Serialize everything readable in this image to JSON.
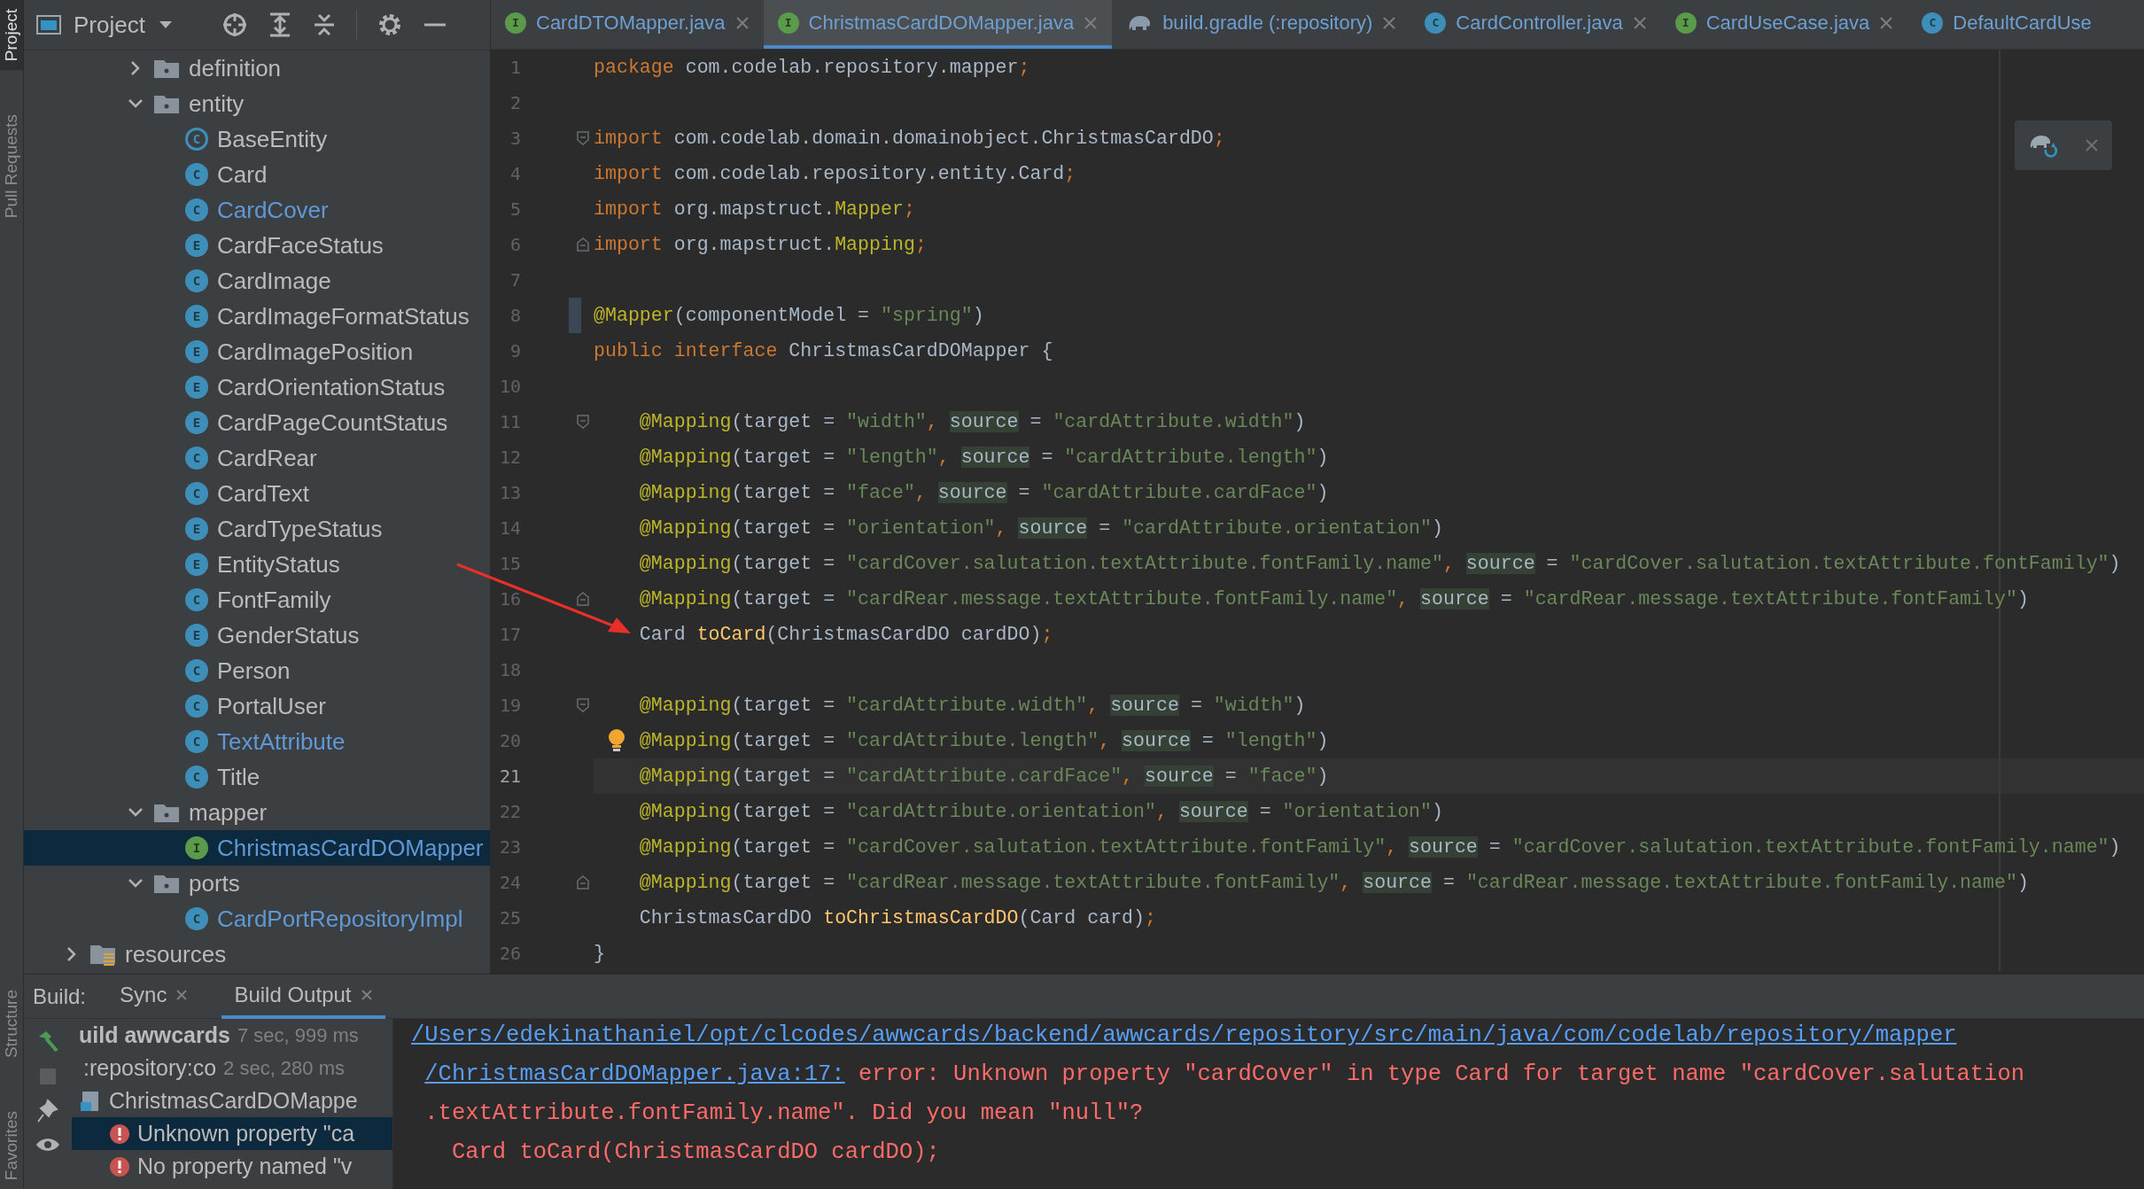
{
  "tool_strip": {
    "top": [
      {
        "label": "Project",
        "selected": true
      },
      {
        "label": "Pull Requests",
        "selected": false
      }
    ],
    "bottom": [
      {
        "label": "Structure",
        "selected": false
      },
      {
        "label": "Favorites",
        "selected": false
      }
    ]
  },
  "project": {
    "title": "Project",
    "tree": [
      {
        "label": "definition",
        "kind": "folder",
        "expanded": false,
        "selected": false
      },
      {
        "label": "entity",
        "kind": "folder",
        "expanded": true,
        "selected": false,
        "children": [
          {
            "label": "BaseEntity",
            "kind": "abstract",
            "badge": "C",
            "modified": false,
            "selected": false
          },
          {
            "label": "Card",
            "kind": "class",
            "badge": "C",
            "modified": false,
            "selected": false
          },
          {
            "label": "CardCover",
            "kind": "class",
            "badge": "C",
            "modified": true,
            "selected": false
          },
          {
            "label": "CardFaceStatus",
            "kind": "enum",
            "badge": "E",
            "modified": false,
            "selected": false
          },
          {
            "label": "CardImage",
            "kind": "class",
            "badge": "C",
            "modified": false,
            "selected": false
          },
          {
            "label": "CardImageFormatStatus",
            "kind": "enum",
            "badge": "E",
            "modified": false,
            "selected": false
          },
          {
            "label": "CardImagePosition",
            "kind": "enum",
            "badge": "E",
            "modified": false,
            "selected": false
          },
          {
            "label": "CardOrientationStatus",
            "kind": "enum",
            "badge": "E",
            "modified": false,
            "selected": false
          },
          {
            "label": "CardPageCountStatus",
            "kind": "enum",
            "badge": "E",
            "modified": false,
            "selected": false
          },
          {
            "label": "CardRear",
            "kind": "class",
            "badge": "C",
            "modified": false,
            "selected": false
          },
          {
            "label": "CardText",
            "kind": "class",
            "badge": "C",
            "modified": false,
            "selected": false
          },
          {
            "label": "CardTypeStatus",
            "kind": "enum",
            "badge": "E",
            "modified": false,
            "selected": false
          },
          {
            "label": "EntityStatus",
            "kind": "enum",
            "badge": "E",
            "modified": false,
            "selected": false
          },
          {
            "label": "FontFamily",
            "kind": "class",
            "badge": "C",
            "modified": false,
            "selected": false
          },
          {
            "label": "GenderStatus",
            "kind": "enum",
            "badge": "E",
            "modified": false,
            "selected": false
          },
          {
            "label": "Person",
            "kind": "class",
            "badge": "C",
            "modified": false,
            "selected": false
          },
          {
            "label": "PortalUser",
            "kind": "class",
            "badge": "C",
            "modified": false,
            "selected": false
          },
          {
            "label": "TextAttribute",
            "kind": "class",
            "badge": "C",
            "modified": true,
            "selected": false
          },
          {
            "label": "Title",
            "kind": "class",
            "badge": "C",
            "modified": false,
            "selected": false
          }
        ]
      },
      {
        "label": "mapper",
        "kind": "folder",
        "expanded": true,
        "selected": false,
        "children": [
          {
            "label": "ChristmasCardDOMapper",
            "kind": "interface",
            "badge": "I",
            "modified": true,
            "selected": true
          }
        ]
      },
      {
        "label": "ports",
        "kind": "folder",
        "expanded": true,
        "selected": false,
        "children": [
          {
            "label": "CardPortRepositoryImpl",
            "kind": "class",
            "badge": "C",
            "modified": true,
            "selected": false
          }
        ]
      }
    ],
    "outer_tree": [
      {
        "label": "resources",
        "kind": "resources-folder",
        "expanded": false,
        "selected": false
      }
    ]
  },
  "tabs": [
    {
      "label": "CardDTOMapper.java",
      "kind": "interface",
      "badge": "I",
      "selected": false
    },
    {
      "label": "ChristmasCardDOMapper.java",
      "kind": "interface",
      "badge": "I",
      "selected": true
    },
    {
      "label": "build.gradle (:repository)",
      "kind": "gradle",
      "selected": false
    },
    {
      "label": "CardController.java",
      "kind": "class",
      "badge": "C",
      "selected": false
    },
    {
      "label": "CardUseCase.java",
      "kind": "interface",
      "badge": "I",
      "selected": false
    },
    {
      "label": "DefaultCardUse",
      "kind": "class",
      "badge": "C",
      "selected": false
    }
  ],
  "editor": {
    "lines": [
      {
        "number": "1",
        "current": false,
        "segments": [
          {
            "kind": "kw",
            "text": "package"
          },
          {
            "kind": "plain",
            "text": " com.codelab.repository.mapper"
          },
          {
            "kind": "kw",
            "text": ";"
          }
        ]
      },
      {
        "number": "2",
        "current": false
      },
      {
        "number": "3",
        "current": false,
        "fold_start": true,
        "segments": [
          {
            "kind": "kw",
            "text": "import"
          },
          {
            "kind": "plain",
            "text": " com.codelab.domain.domainobject.ChristmasCardDO"
          },
          {
            "kind": "kw",
            "text": ";"
          }
        ]
      },
      {
        "number": "4",
        "current": false,
        "segments": [
          {
            "kind": "kw",
            "text": "import"
          },
          {
            "kind": "plain",
            "text": " com.codelab.repository.entity.Card"
          },
          {
            "kind": "kw",
            "text": ";"
          }
        ]
      },
      {
        "number": "5",
        "current": false,
        "segments": [
          {
            "kind": "kw",
            "text": "import"
          },
          {
            "kind": "plain",
            "text": " org.mapstruct."
          },
          {
            "kind": "ann",
            "text": "Mapper"
          },
          {
            "kind": "kw",
            "text": ";"
          }
        ]
      },
      {
        "number": "6",
        "current": false,
        "fold_end": true,
        "segments": [
          {
            "kind": "kw",
            "text": "import"
          },
          {
            "kind": "plain",
            "text": " org.mapstruct."
          },
          {
            "kind": "ann",
            "text": "Mapping"
          },
          {
            "kind": "kw",
            "text": ";"
          }
        ]
      },
      {
        "number": "7",
        "current": false
      },
      {
        "number": "8",
        "current": false,
        "changed": true,
        "segments": [
          {
            "kind": "ann",
            "text": "@Mapper"
          },
          {
            "kind": "plain",
            "text": "(componentModel = "
          },
          {
            "kind": "str",
            "text": "\"spring\""
          },
          {
            "kind": "plain",
            "text": ")"
          }
        ]
      },
      {
        "number": "9",
        "current": false,
        "segments": [
          {
            "kind": "kw",
            "text": "public interface"
          },
          {
            "kind": "plain",
            "text": " ChristmasCardDOMapper {"
          }
        ]
      },
      {
        "number": "10",
        "current": false
      },
      {
        "number": "11",
        "current": false,
        "indented": true,
        "fold_start": true,
        "segments": [
          {
            "kind": "ann",
            "text": "@Mapping"
          },
          {
            "kind": "plain",
            "text": "(target = "
          },
          {
            "kind": "str",
            "text": "\"width\""
          },
          {
            "kind": "kw",
            "text": ", "
          },
          {
            "kind": "hl",
            "text": "source"
          },
          {
            "kind": "plain",
            "text": " = "
          },
          {
            "kind": "str",
            "text": "\"cardAttribute.width\""
          },
          {
            "kind": "plain",
            "text": ")"
          }
        ]
      },
      {
        "number": "12",
        "current": false,
        "indented": true,
        "segments": [
          {
            "kind": "ann",
            "text": "@Mapping"
          },
          {
            "kind": "plain",
            "text": "(target = "
          },
          {
            "kind": "str",
            "text": "\"length\""
          },
          {
            "kind": "kw",
            "text": ", "
          },
          {
            "kind": "hl",
            "text": "source"
          },
          {
            "kind": "plain",
            "text": " = "
          },
          {
            "kind": "str",
            "text": "\"cardAttribute.length\""
          },
          {
            "kind": "plain",
            "text": ")"
          }
        ]
      },
      {
        "number": "13",
        "current": false,
        "indented": true,
        "segments": [
          {
            "kind": "ann",
            "text": "@Mapping"
          },
          {
            "kind": "plain",
            "text": "(target = "
          },
          {
            "kind": "str",
            "text": "\"face\""
          },
          {
            "kind": "kw",
            "text": ", "
          },
          {
            "kind": "hl",
            "text": "source"
          },
          {
            "kind": "plain",
            "text": " = "
          },
          {
            "kind": "str",
            "text": "\"cardAttribute.cardFace\""
          },
          {
            "kind": "plain",
            "text": ")"
          }
        ]
      },
      {
        "number": "14",
        "current": false,
        "indented": true,
        "segments": [
          {
            "kind": "ann",
            "text": "@Mapping"
          },
          {
            "kind": "plain",
            "text": "(target = "
          },
          {
            "kind": "str",
            "text": "\"orientation\""
          },
          {
            "kind": "kw",
            "text": ", "
          },
          {
            "kind": "hl",
            "text": "source"
          },
          {
            "kind": "plain",
            "text": " = "
          },
          {
            "kind": "str",
            "text": "\"cardAttribute.orientation\""
          },
          {
            "kind": "plain",
            "text": ")"
          }
        ]
      },
      {
        "number": "15",
        "current": false,
        "indented": true,
        "segments": [
          {
            "kind": "ann",
            "text": "@Mapping"
          },
          {
            "kind": "plain",
            "text": "(target = "
          },
          {
            "kind": "str",
            "text": "\"cardCover.salutation.textAttribute.fontFamily.name\""
          },
          {
            "kind": "kw",
            "text": ", "
          },
          {
            "kind": "hl",
            "text": "source"
          },
          {
            "kind": "plain",
            "text": " = "
          },
          {
            "kind": "str",
            "text": "\"cardCover.salutation.textAttribute.fontFamily\""
          },
          {
            "kind": "plain",
            "text": ")"
          }
        ]
      },
      {
        "number": "16",
        "current": false,
        "indented": true,
        "fold_end": true,
        "segments": [
          {
            "kind": "ann",
            "text": "@Mapping"
          },
          {
            "kind": "plain",
            "text": "(target = "
          },
          {
            "kind": "str",
            "text": "\"cardRear.message.textAttribute.fontFamily.name\""
          },
          {
            "kind": "kw",
            "text": ", "
          },
          {
            "kind": "hl",
            "text": "source"
          },
          {
            "kind": "plain",
            "text": " = "
          },
          {
            "kind": "str",
            "text": "\"cardRear.message.textAttribute.fontFamily\""
          },
          {
            "kind": "plain",
            "text": ")"
          }
        ]
      },
      {
        "number": "17",
        "current": false,
        "indented": true,
        "segments": [
          {
            "kind": "plain",
            "text": "Card "
          },
          {
            "kind": "fn",
            "text": "toCard"
          },
          {
            "kind": "plain",
            "text": "(ChristmasCardDO cardDO)"
          },
          {
            "kind": "kw",
            "text": ";"
          }
        ]
      },
      {
        "number": "18",
        "current": false
      },
      {
        "number": "19",
        "current": false,
        "indented": true,
        "fold_start": true,
        "segments": [
          {
            "kind": "ann",
            "text": "@Mapping"
          },
          {
            "kind": "plain",
            "text": "(target = "
          },
          {
            "kind": "str",
            "text": "\"cardAttribute.width\""
          },
          {
            "kind": "kw",
            "text": ", "
          },
          {
            "kind": "hl",
            "text": "source"
          },
          {
            "kind": "plain",
            "text": " = "
          },
          {
            "kind": "str",
            "text": "\"width\""
          },
          {
            "kind": "plain",
            "text": ")"
          }
        ]
      },
      {
        "number": "20",
        "current": false,
        "indented": true,
        "bulb": true,
        "segments": [
          {
            "kind": "ann",
            "text": "@Mapping"
          },
          {
            "kind": "plain",
            "text": "(target = "
          },
          {
            "kind": "str",
            "text": "\"cardAttribute.length\""
          },
          {
            "kind": "kw",
            "text": ", "
          },
          {
            "kind": "hl",
            "text": "source"
          },
          {
            "kind": "plain",
            "text": " = "
          },
          {
            "kind": "str",
            "text": "\"length\""
          },
          {
            "kind": "plain",
            "text": ")"
          }
        ]
      },
      {
        "number": "21",
        "current": true,
        "indented": true,
        "segments": [
          {
            "kind": "ann",
            "text": "@Mapping"
          },
          {
            "kind": "plain",
            "text": "(target = "
          },
          {
            "kind": "str",
            "text": "\"cardAttribute.cardFace\""
          },
          {
            "kind": "kw",
            "text": ", "
          },
          {
            "kind": "hl",
            "text": "source"
          },
          {
            "kind": "plain",
            "text": " = "
          },
          {
            "kind": "str",
            "text": "\"face\""
          },
          {
            "kind": "plain",
            "text": ")"
          }
        ]
      },
      {
        "number": "22",
        "current": false,
        "indented": true,
        "segments": [
          {
            "kind": "ann",
            "text": "@Mapping"
          },
          {
            "kind": "plain",
            "text": "(target = "
          },
          {
            "kind": "str",
            "text": "\"cardAttribute.orientation\""
          },
          {
            "kind": "kw",
            "text": ", "
          },
          {
            "kind": "hl",
            "text": "source"
          },
          {
            "kind": "plain",
            "text": " = "
          },
          {
            "kind": "str",
            "text": "\"orientation\""
          },
          {
            "kind": "plain",
            "text": ")"
          }
        ]
      },
      {
        "number": "23",
        "current": false,
        "indented": true,
        "segments": [
          {
            "kind": "ann",
            "text": "@Mapping"
          },
          {
            "kind": "plain",
            "text": "(target = "
          },
          {
            "kind": "str",
            "text": "\"cardCover.salutation.textAttribute.fontFamily\""
          },
          {
            "kind": "kw",
            "text": ", "
          },
          {
            "kind": "hl",
            "text": "source"
          },
          {
            "kind": "plain",
            "text": " = "
          },
          {
            "kind": "str",
            "text": "\"cardCover.salutation.textAttribute.fontFamily.name\""
          },
          {
            "kind": "plain",
            "text": ")"
          }
        ]
      },
      {
        "number": "24",
        "current": false,
        "indented": true,
        "fold_end": true,
        "segments": [
          {
            "kind": "ann",
            "text": "@Mapping"
          },
          {
            "kind": "plain",
            "text": "(target = "
          },
          {
            "kind": "str",
            "text": "\"cardRear.message.textAttribute.fontFamily\""
          },
          {
            "kind": "kw",
            "text": ", "
          },
          {
            "kind": "hl",
            "text": "source"
          },
          {
            "kind": "plain",
            "text": " = "
          },
          {
            "kind": "str",
            "text": "\"cardRear.message.textAttribute.fontFamily.name\""
          },
          {
            "kind": "plain",
            "text": ")"
          }
        ]
      },
      {
        "number": "25",
        "current": false,
        "indented": true,
        "segments": [
          {
            "kind": "plain",
            "text": "ChristmasCardDO "
          },
          {
            "kind": "fn",
            "text": "toChristmasCardDO"
          },
          {
            "kind": "plain",
            "text": "(Card card)"
          },
          {
            "kind": "kw",
            "text": ";"
          }
        ]
      },
      {
        "number": "26",
        "current": false,
        "segments": [
          {
            "kind": "plain",
            "text": "}"
          }
        ]
      }
    ]
  },
  "build": {
    "label": "Build:",
    "tabs": [
      {
        "label": "Sync",
        "selected": false
      },
      {
        "label": "Build Output",
        "selected": true
      }
    ],
    "tree": [
      {
        "label": "uild awwcards",
        "time": "7 sec, 999 ms",
        "selected": false,
        "children": [
          {
            "label": ":repository:co",
            "time": "2 sec, 280 ms",
            "selected": false,
            "children": [
              {
                "label": "ChristmasCardDOMappe",
                "kind": "file",
                "selected": false,
                "children": [
                  {
                    "label": "Unknown property \"ca",
                    "kind": "error",
                    "selected": true
                  },
                  {
                    "label": "No property named \"v",
                    "kind": "error",
                    "selected": false
                  }
                ]
              }
            ]
          }
        ]
      }
    ],
    "output": [
      {
        "segments": [
          {
            "kind": "link",
            "text": "/Users/edekinathaniel/opt/clcodes/awwcards/backend/awwcards/repository/src/main/java/com/codelab/repository/mapper"
          }
        ]
      },
      {
        "indented": true,
        "segments": [
          {
            "kind": "link",
            "text": "/ChristmasCardDOMapper.java:17:"
          },
          {
            "kind": "error",
            "text": " error: Unknown property \"cardCover\" in type Card for target name \"cardCover.salutation"
          }
        ]
      },
      {
        "indented": true,
        "segments": [
          {
            "kind": "error",
            "text": ".textAttribute.fontFamily.name\". Did you mean \"null\"?"
          }
        ]
      },
      {
        "indented": true,
        "segments": [
          {
            "kind": "error",
            "text": "  Card toCard(ChristmasCardDO cardDO);"
          }
        ]
      }
    ]
  }
}
